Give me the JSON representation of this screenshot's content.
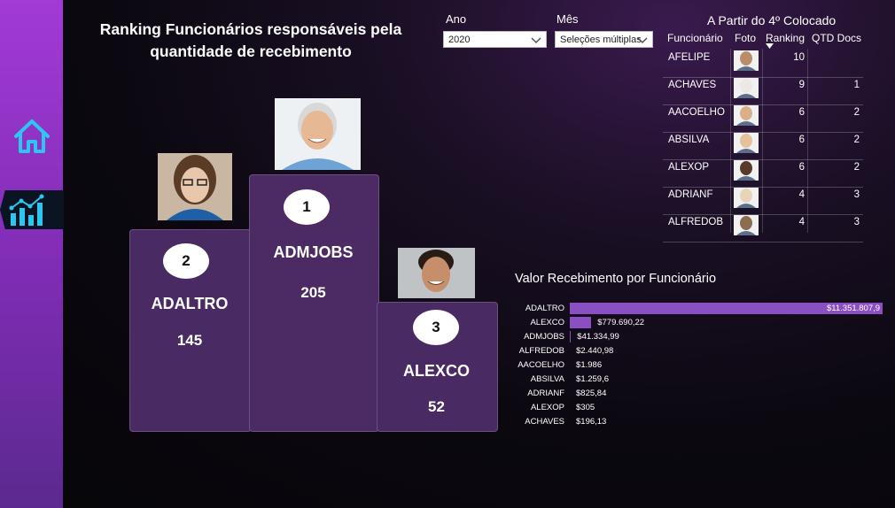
{
  "title": "Ranking Funcionários responsáveis pela quantidade de recebimento",
  "nav": {
    "home_icon": "home-icon",
    "chart_icon": "bar-chart-icon"
  },
  "filters": {
    "ano": {
      "label": "Ano",
      "value": "2020"
    },
    "mes": {
      "label": "Mês",
      "value": "Seleções múltiplas"
    }
  },
  "podium": [
    {
      "rank": "1",
      "name": "ADMJOBS",
      "value": "205"
    },
    {
      "rank": "2",
      "name": "ADALTRO",
      "value": "145"
    },
    {
      "rank": "3",
      "name": "ALEXCO",
      "value": "52"
    }
  ],
  "table": {
    "title": "A Partir do 4º Colocado",
    "headers": {
      "funcionario": "Funcionário",
      "foto": "Foto",
      "ranking": "Ranking",
      "qtd": "QTD Docs"
    },
    "rows": [
      {
        "name": "AFELIPE",
        "ranking": "10",
        "qtd": ""
      },
      {
        "name": "ACHAVES",
        "ranking": "9",
        "qtd": "1"
      },
      {
        "name": "AACOELHO",
        "ranking": "6",
        "qtd": "2"
      },
      {
        "name": "ABSILVA",
        "ranking": "6",
        "qtd": "2"
      },
      {
        "name": "ALEXOP",
        "ranking": "6",
        "qtd": "2"
      },
      {
        "name": "ADRIANF",
        "ranking": "4",
        "qtd": "3"
      },
      {
        "name": "ALFREDOB",
        "ranking": "4",
        "qtd": "3"
      }
    ]
  },
  "chart_data": {
    "type": "bar",
    "orientation": "horizontal",
    "title": "Valor Recebimento por Funcionário",
    "categories": [
      "ADALTRO",
      "ALEXCO",
      "ADMJOBS",
      "ALFREDOB",
      "AACOELHO",
      "ABSILVA",
      "ADRIANF",
      "ALEXOP",
      "ACHAVES"
    ],
    "values": [
      11351807.9,
      779690.22,
      41334.99,
      2440.98,
      1986,
      1259.6,
      825.84,
      305,
      196.13
    ],
    "labels": [
      "$11.351.807,9",
      "$779.690,22",
      "$41.334,99",
      "$2.440,98",
      "$1.986",
      "$1.259,6",
      "$825,84",
      "$305",
      "$196,13"
    ],
    "bar_color": "#8a4fc2"
  },
  "colors": {
    "sidebar": "#8e33c4",
    "podium": "#4a2a62",
    "accent_icon": "#2cc6f0"
  }
}
